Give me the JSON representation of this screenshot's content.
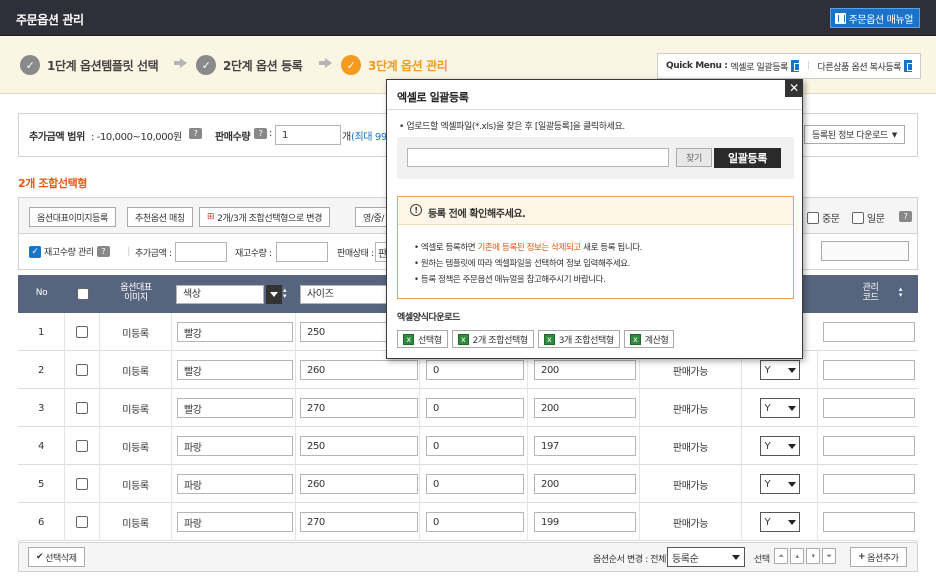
{
  "header": {
    "title": "주문옵션 관리",
    "manual_label": "주문옵션 매뉴얼"
  },
  "steps": [
    {
      "num": "✓",
      "label": "1단계 옵션템플릿 선택"
    },
    {
      "num": "✓",
      "label": "2단계 옵션 등록"
    },
    {
      "num": "✓",
      "label": "3단계 옵션 관리"
    }
  ],
  "quick_menu": {
    "label": "Quick Menu :",
    "excel_upload": "엑셀로 일괄등록",
    "copy_other": "다른상품 옵션 복사등록"
  },
  "filter": {
    "price_range_label": "추가금액 범위",
    "price_range_value": ": -10,000~10,000원",
    "sale_qty_label": "판매수량",
    "sale_qty_value": "1",
    "sale_qty_suffix": "개",
    "sale_qty_max": "(최대 99",
    "download_label": "등록된 정보 다운로드"
  },
  "section_title": "2개 조합선택형",
  "toolbar": {
    "btn_image_register": "옵션대표이미지등록",
    "btn_recommend": "추천옵션 매칭",
    "btn_convert": "2개/3개 조합선택형으로 변경",
    "btn_lang": "영/중/",
    "dup_label": "중문",
    "jp_label": "일문"
  },
  "subbar": {
    "stock_label": "재고수량 관리",
    "add_price_label": "추가금액 :",
    "stock_qty_label": "재고수량 :",
    "sale_status_label": "판매상태 :",
    "sale_status_value": "판"
  },
  "grid": {
    "headers": {
      "no": "No",
      "image": "옵션대표\n이미지",
      "opt1": "색상",
      "opt2": "사이즈",
      "mgmt_code": "관리\n코드"
    },
    "rows": [
      {
        "no": "1",
        "image": "미등록",
        "color": "빨강",
        "size": "250",
        "price": "",
        "stock": "",
        "status": "",
        "use": ""
      },
      {
        "no": "2",
        "image": "미등록",
        "color": "빨강",
        "size": "260",
        "price": "0",
        "stock": "200",
        "status": "판매가능",
        "use": "Y"
      },
      {
        "no": "3",
        "image": "미등록",
        "color": "빨강",
        "size": "270",
        "price": "0",
        "stock": "200",
        "status": "판매가능",
        "use": "Y"
      },
      {
        "no": "4",
        "image": "미등록",
        "color": "파랑",
        "size": "250",
        "price": "0",
        "stock": "197",
        "status": "판매가능",
        "use": "Y"
      },
      {
        "no": "5",
        "image": "미등록",
        "color": "파랑",
        "size": "260",
        "price": "0",
        "stock": "200",
        "status": "판매가능",
        "use": "Y"
      },
      {
        "no": "6",
        "image": "미등록",
        "color": "파랑",
        "size": "270",
        "price": "0",
        "stock": "199",
        "status": "판매가능",
        "use": "Y"
      }
    ]
  },
  "bottom": {
    "delete_label": "선택삭제",
    "order_change_label": "옵션순서 변경 : 전체",
    "order_select": "등록순",
    "select_label": "선택",
    "add_option_label": "옵션추가"
  },
  "modal": {
    "title": "엑셀로 일괄등록",
    "instruction": "업로드할 엑셀파일(*.xls)을 찾은 후 [일괄등록]을 클릭하세요.",
    "find_label": "찾기",
    "upload_label": "일괄등록",
    "warn_title": "등록 전에 확인해주세요.",
    "warn_line1_pre": "엑셀로 등록하면 ",
    "warn_line1_hl": "기존에 등록된 정보는 삭제되고",
    "warn_line1_post": " 새로 등록 됩니다.",
    "warn_line2": "원하는 템플릿에 따라 엑셀파일을 선택하여 정보 입력해주세요.",
    "warn_line3": "등록 정책은 주문옵션 매뉴얼을 참고해주시기 바랍니다.",
    "download_title": "엑셀양식다운로드",
    "downloads": [
      "선택형",
      "2개 조합선택형",
      "3개 조합선택형",
      "계산형"
    ]
  }
}
